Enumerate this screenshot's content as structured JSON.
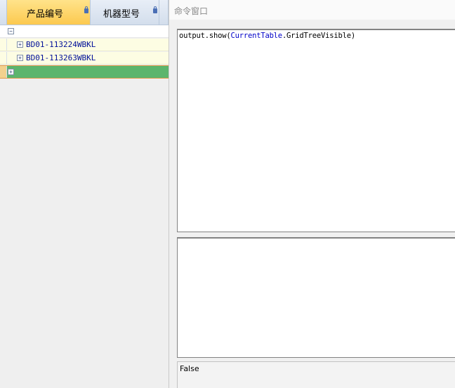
{
  "grid": {
    "columns": [
      {
        "label": "产品编号"
      },
      {
        "label": "机器型号"
      }
    ],
    "rows": [
      {
        "label": ""
      },
      {
        "label": "BD01-113224WBKL"
      },
      {
        "label": "BD01-113263WBKL"
      }
    ],
    "expander_collapsed": "+",
    "expander_expanded": "−"
  },
  "command_window": {
    "title": "命令窗口",
    "code": {
      "prefix": "output.show(",
      "keyword": "CurrentTable",
      "suffix": ".GridTreeVisible)"
    },
    "result": "False"
  },
  "colors": {
    "selected_row": "#5cb56d",
    "active_header": "#fcc94f",
    "keyword": "#0000c8",
    "row_text": "#000f99"
  }
}
